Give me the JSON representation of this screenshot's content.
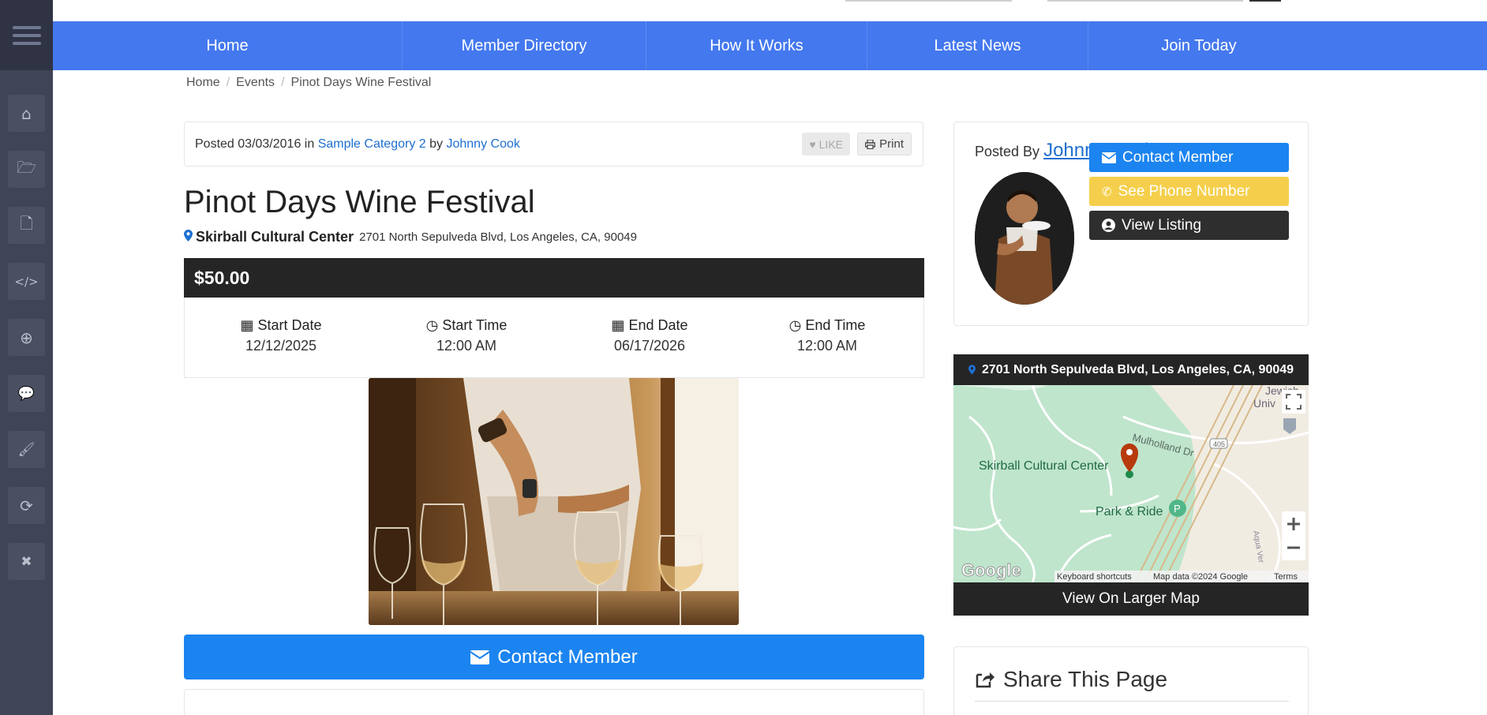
{
  "sidebar": {
    "menu_icon": "hamburger-icon",
    "items": [
      {
        "icon": "home-icon",
        "glyph": "⌂"
      },
      {
        "icon": "folder-open-icon",
        "glyph": "🗁"
      },
      {
        "icon": "file-icon",
        "glyph": "🗋"
      },
      {
        "icon": "code-icon",
        "glyph": "</>"
      },
      {
        "icon": "zoom-icon",
        "glyph": "⊕"
      },
      {
        "icon": "comments-icon",
        "glyph": "💬"
      },
      {
        "icon": "brush-icon",
        "glyph": "🖌"
      },
      {
        "icon": "refresh-icon",
        "glyph": "⟳"
      },
      {
        "icon": "close-icon",
        "glyph": "✖"
      }
    ]
  },
  "nav": {
    "items": [
      "Home",
      "Member Directory",
      "How It Works",
      "Latest News",
      "Join Today"
    ]
  },
  "breadcrumb": [
    "Home",
    "Events",
    "Pinot Days Wine Festival"
  ],
  "post": {
    "posted_prefix": "Posted",
    "date": "03/03/2016",
    "in_word": "in",
    "category": "Sample Category 2",
    "by_word": "by",
    "author": "Johnny Cook",
    "like_label": "LIKE",
    "print_label": "Print"
  },
  "event": {
    "title": "Pinot Days Wine Festival",
    "venue": "Skirball Cultural Center",
    "address": "2701 North Sepulveda Blvd, Los Angeles, CA, 90049",
    "price": "$50.00",
    "dates": [
      {
        "label": "Start Date",
        "value": "12/12/2025",
        "icon": "calendar-icon"
      },
      {
        "label": "Start Time",
        "value": "12:00 AM",
        "icon": "clock-icon"
      },
      {
        "label": "End Date",
        "value": "06/17/2026",
        "icon": "calendar-icon"
      },
      {
        "label": "End Time",
        "value": "12:00 AM",
        "icon": "clock-icon"
      }
    ],
    "contact_label": "Contact Member"
  },
  "author_card": {
    "posted_by": "Posted By",
    "name": "Johnny Cook",
    "buttons": {
      "contact": "Contact Member",
      "phone": "See Phone Number",
      "listing": "View Listing"
    },
    "colors": {
      "contact": "#1c84f0",
      "phone": "#f5cf4c",
      "listing": "#2e2e2e"
    }
  },
  "map": {
    "address": "2701 North Sepulveda Blvd, Los Angeles, CA, 90049",
    "labels": {
      "place": "Skirball Cultural Center",
      "road": "Mulholland Dr",
      "park": "Park & Ride",
      "top": "Jewish",
      "top2": "Univ",
      "shield": "405",
      "side": "Aqua Ver"
    },
    "attribution": {
      "logo": "Google",
      "shortcuts": "Keyboard shortcuts",
      "data": "Map data ©2024 Google",
      "terms": "Terms"
    },
    "larger_map": "View On Larger Map"
  },
  "share": {
    "title": "Share This Page"
  }
}
